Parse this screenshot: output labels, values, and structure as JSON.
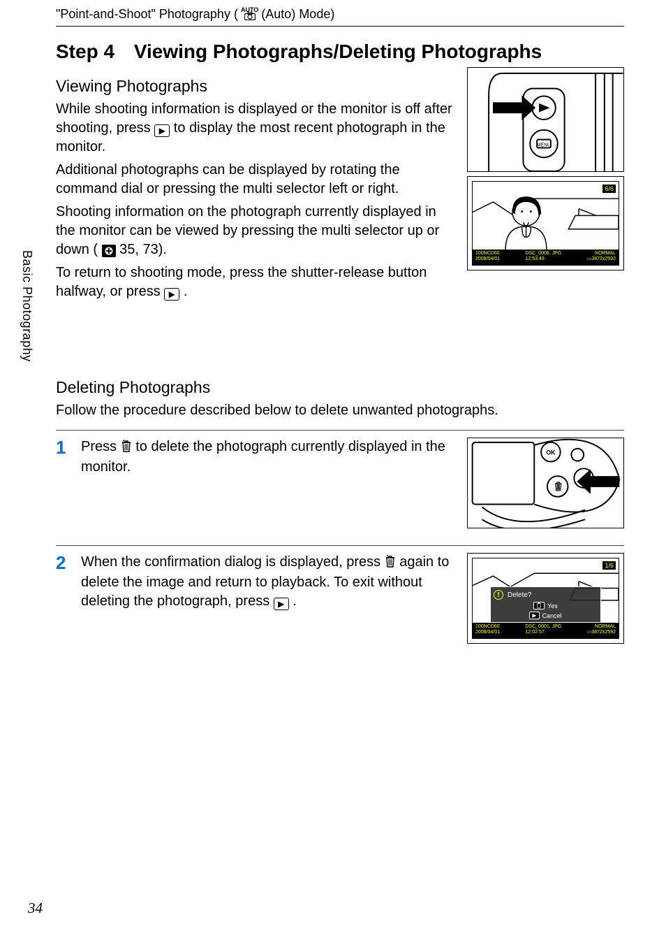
{
  "running_head": {
    "prefix": "\"Point-and-Shoot\" Photography (",
    "mode": " (Auto) Mode)",
    "auto_label": "AUTO"
  },
  "sidebar": {
    "label": "Basic Photography"
  },
  "section": {
    "step_label": "Step 4",
    "title": "Viewing Photographs/Deleting Photographs"
  },
  "viewing": {
    "heading": "Viewing Photographs",
    "p1a": "While shooting information is displayed or the monitor is off after shooting, press ",
    "p1b": " to display the most recent photograph in the monitor.",
    "p2": "Additional photographs can be displayed by rotating the command dial or pressing the multi selector left or right.",
    "p3a": "Shooting information on the photograph currently displayed in the monitor can be viewed by pressing the multi selector up or down (",
    "p3b": " 35, 73).",
    "p4a": "To return to shooting mode, press the shutter-release button halfway, or press ",
    "p4b": "."
  },
  "deleting": {
    "heading": "Deleting Photographs",
    "intro": "Follow the procedure described below to delete unwanted photographs.",
    "steps": [
      {
        "num": "1",
        "a": "Press ",
        "b": " to delete the photograph currently displayed in the monitor."
      },
      {
        "num": "2",
        "a": "When the confirmation dialog is displayed, press ",
        "b": " again to delete the image and return to playback. To exit without deleting the photograph, press ",
        "c": "."
      }
    ]
  },
  "illus": {
    "camera_back": {
      "menu_label": "MENU"
    },
    "playback": {
      "count": "6/6",
      "info_left_top": "100NCD60",
      "info_left_bottom": "2008/04/01",
      "info_mid_top": "DSC_0006. JPG",
      "info_mid_bottom": "12:53:49",
      "info_right_top": "NORMAL",
      "info_right_bottom": "3872x2592"
    },
    "confirm": {
      "count": "1/6",
      "question": "Delete?",
      "yes": "Yes",
      "cancel": "Cancel",
      "info_left_top": "100NCD60",
      "info_left_bottom": "2008/04/01",
      "info_mid_top": "DSC_0001. JPG",
      "info_mid_bottom": "12:02:57",
      "info_right_top": "NORMAL",
      "info_right_bottom": "3872x2592"
    }
  },
  "icons": {
    "play": "▶",
    "camera_ref": "📷",
    "trash": "trash",
    "ok": "OK"
  },
  "page_number": "34"
}
